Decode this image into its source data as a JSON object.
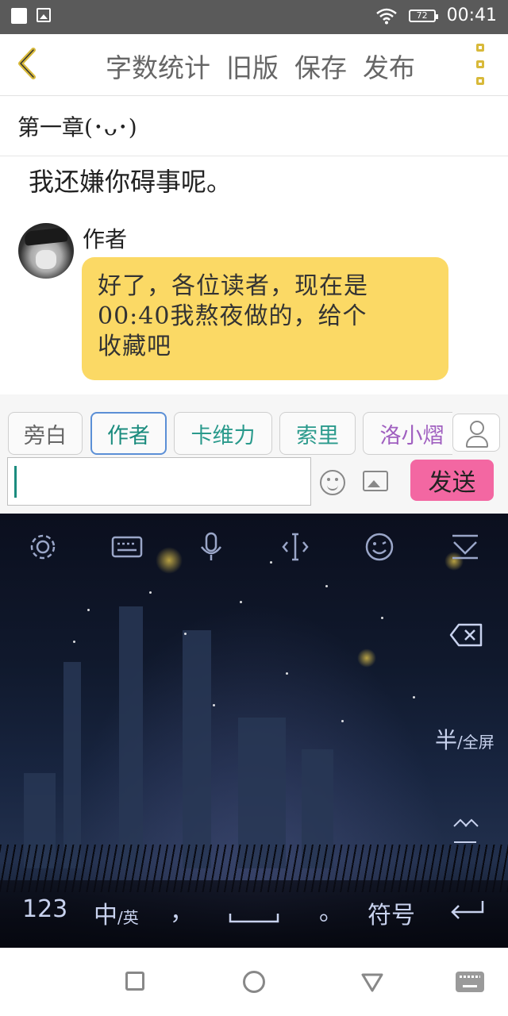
{
  "status_bar": {
    "battery": "72",
    "time": "00:41"
  },
  "header": {
    "buttons": [
      "字数统计",
      "旧版",
      "保存",
      "发布"
    ]
  },
  "chapter": {
    "title": "第一章(･ᴗ･)"
  },
  "content": {
    "narration": "我还嫌你碍事呢。",
    "speaker": "作者",
    "bubble_lines": [
      "好了，各位读者，现在是",
      "00:40我熬夜做的，给个",
      "收藏吧"
    ]
  },
  "characters": [
    {
      "label": "旁白",
      "color": "#666666"
    },
    {
      "label": "作者",
      "color": "#1b8c7e"
    },
    {
      "label": "卡维力",
      "color": "#2a9a8c"
    },
    {
      "label": "索里",
      "color": "#2a9a8c"
    },
    {
      "label": "洛小熠",
      "color": "#a060c0"
    }
  ],
  "composer": {
    "send_label": "发送"
  },
  "keyboard": {
    "half_full": "半",
    "half_full_sub": "/全屏",
    "bottom": {
      "num": "123",
      "lang": "中",
      "lang_sub": "/英",
      "comma": "，",
      "period": "。",
      "symbols": "符号"
    }
  },
  "colors": {
    "bubble": "#fbd965",
    "send": "#f367a2",
    "accent": "#d8b93a"
  }
}
